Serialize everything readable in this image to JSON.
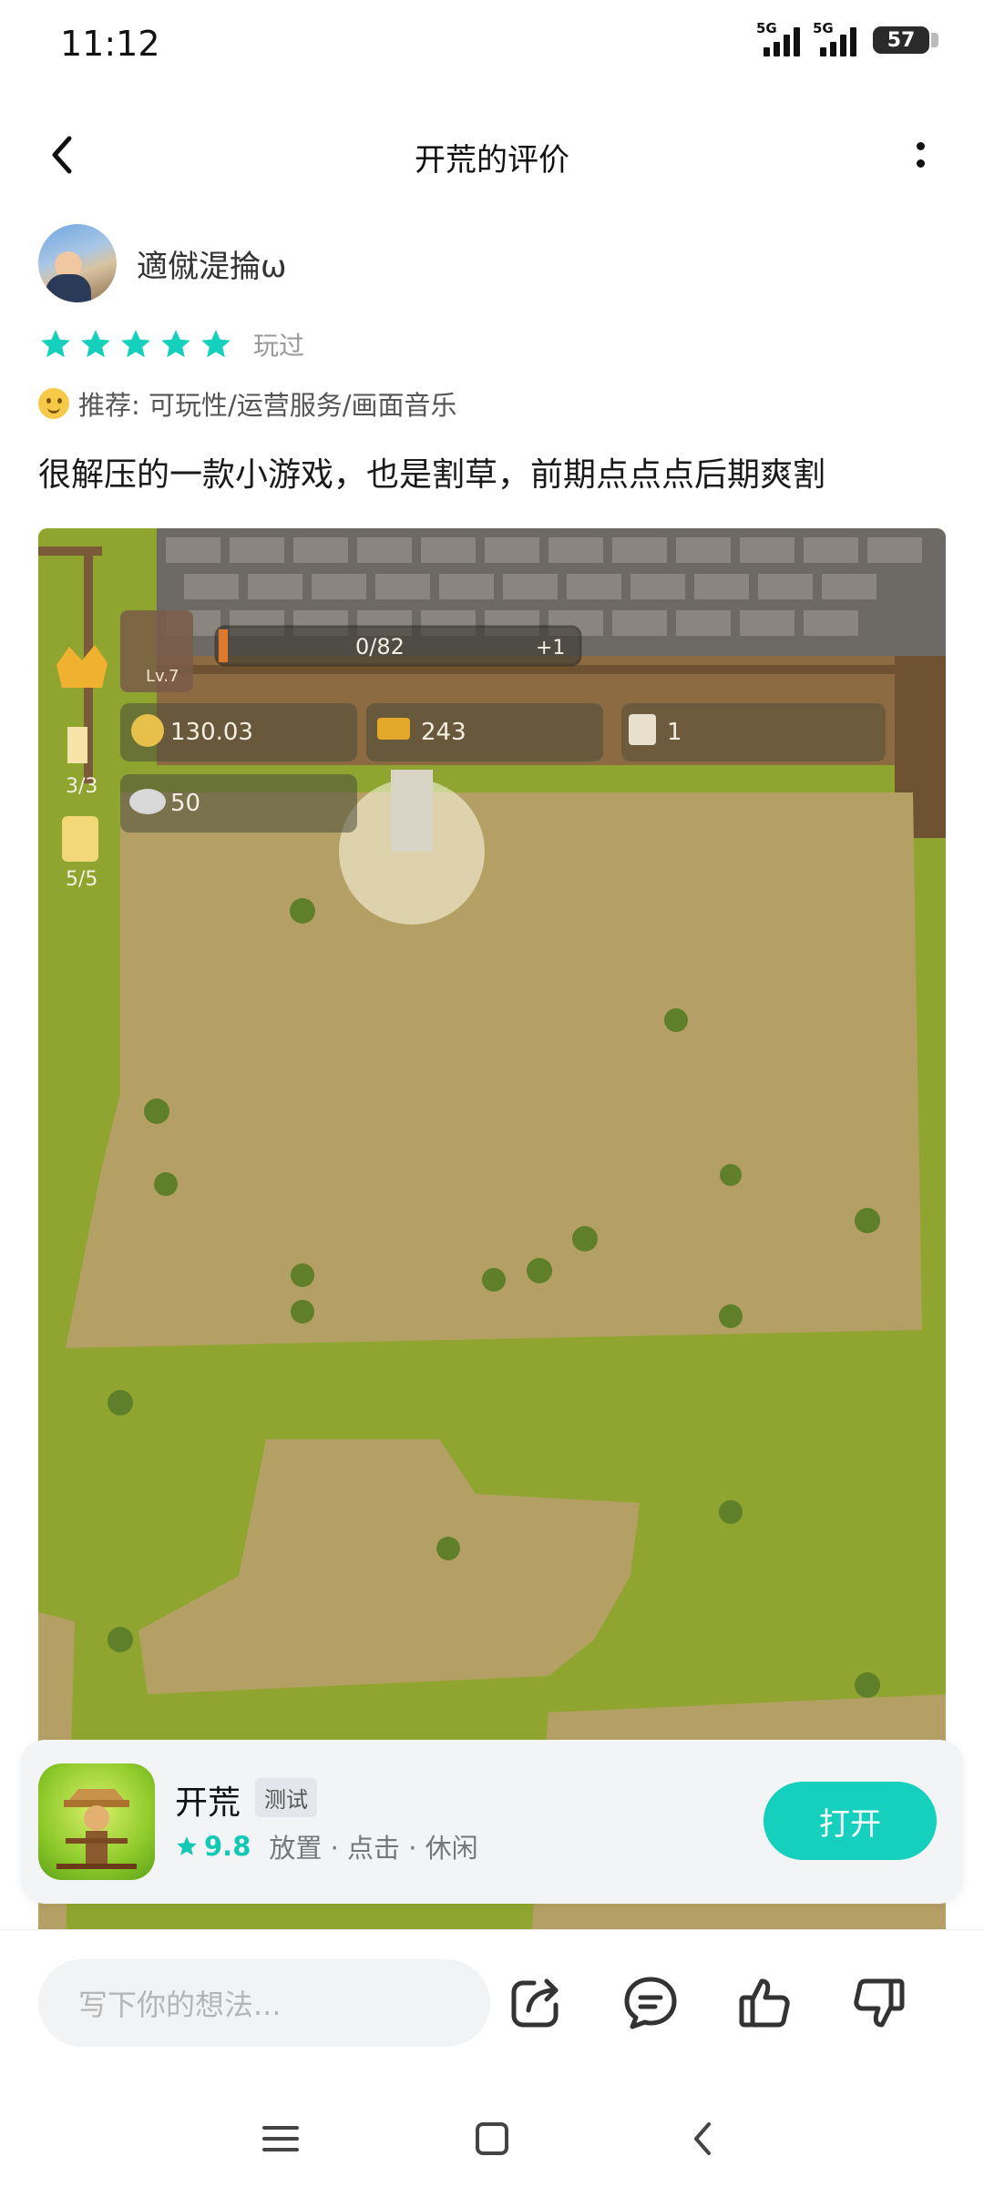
{
  "status": {
    "time": "11:12",
    "signal1_label": "5G",
    "signal2_label": "5G",
    "battery": "57"
  },
  "header": {
    "title": "开荒的评价",
    "back_icon": "chevron-left-icon",
    "more_icon": "more-vertical-icon"
  },
  "review": {
    "username": "適僦湜掄ω",
    "stars": 5,
    "played_label": "玩过",
    "recommend": "推荐: 可玩性/运营服务/画面音乐",
    "text": "很解压的一款小游戏，也是割草，前期点点点后期爽割",
    "star_color": "#14d0bc"
  },
  "game_ui": {
    "level": "Lv.7",
    "progress": "0/82",
    "bonus": "+1",
    "gold": "130.03",
    "gold_label": "金币",
    "bars": "243",
    "bars_label": "金砖",
    "talent": "1",
    "talent_label": "天赋点",
    "stone": "50",
    "stone_label": "技能石",
    "candle": "3/3",
    "beer": "5/5"
  },
  "app_card": {
    "name": "开荒",
    "tag": "测试",
    "score": "9.8",
    "categories": "放置 · 点击 · 休闲",
    "open_label": "打开",
    "accent": "#14d0bc"
  },
  "action_bar": {
    "placeholder": "写下你的想法...",
    "icons": [
      "share-icon",
      "comment-icon",
      "thumbs-up-icon",
      "thumbs-down-icon"
    ]
  },
  "nav": {
    "icons": [
      "menu-icon",
      "home-icon",
      "back-icon"
    ]
  }
}
